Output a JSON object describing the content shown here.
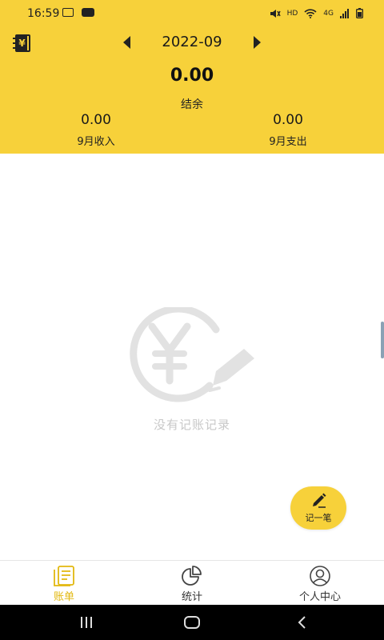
{
  "status_bar": {
    "time": "16:59",
    "network_label": "HD",
    "signal_label": "4G"
  },
  "header": {
    "month": "2022-09",
    "balance_value": "0.00",
    "balance_label": "结余",
    "income_value": "0.00",
    "income_label": "9月收入",
    "expense_value": "0.00",
    "expense_label": "9月支出",
    "accent_color": "#f7d13a"
  },
  "empty_state": {
    "message": "没有记账记录"
  },
  "fab": {
    "label": "记一笔"
  },
  "bottom_nav": {
    "items": [
      {
        "label": "账单",
        "icon": "bill-icon",
        "active": true
      },
      {
        "label": "统计",
        "icon": "pie-chart-icon",
        "active": false
      },
      {
        "label": "个人中心",
        "icon": "user-icon",
        "active": false
      }
    ],
    "active_color": "#e2b80f"
  }
}
